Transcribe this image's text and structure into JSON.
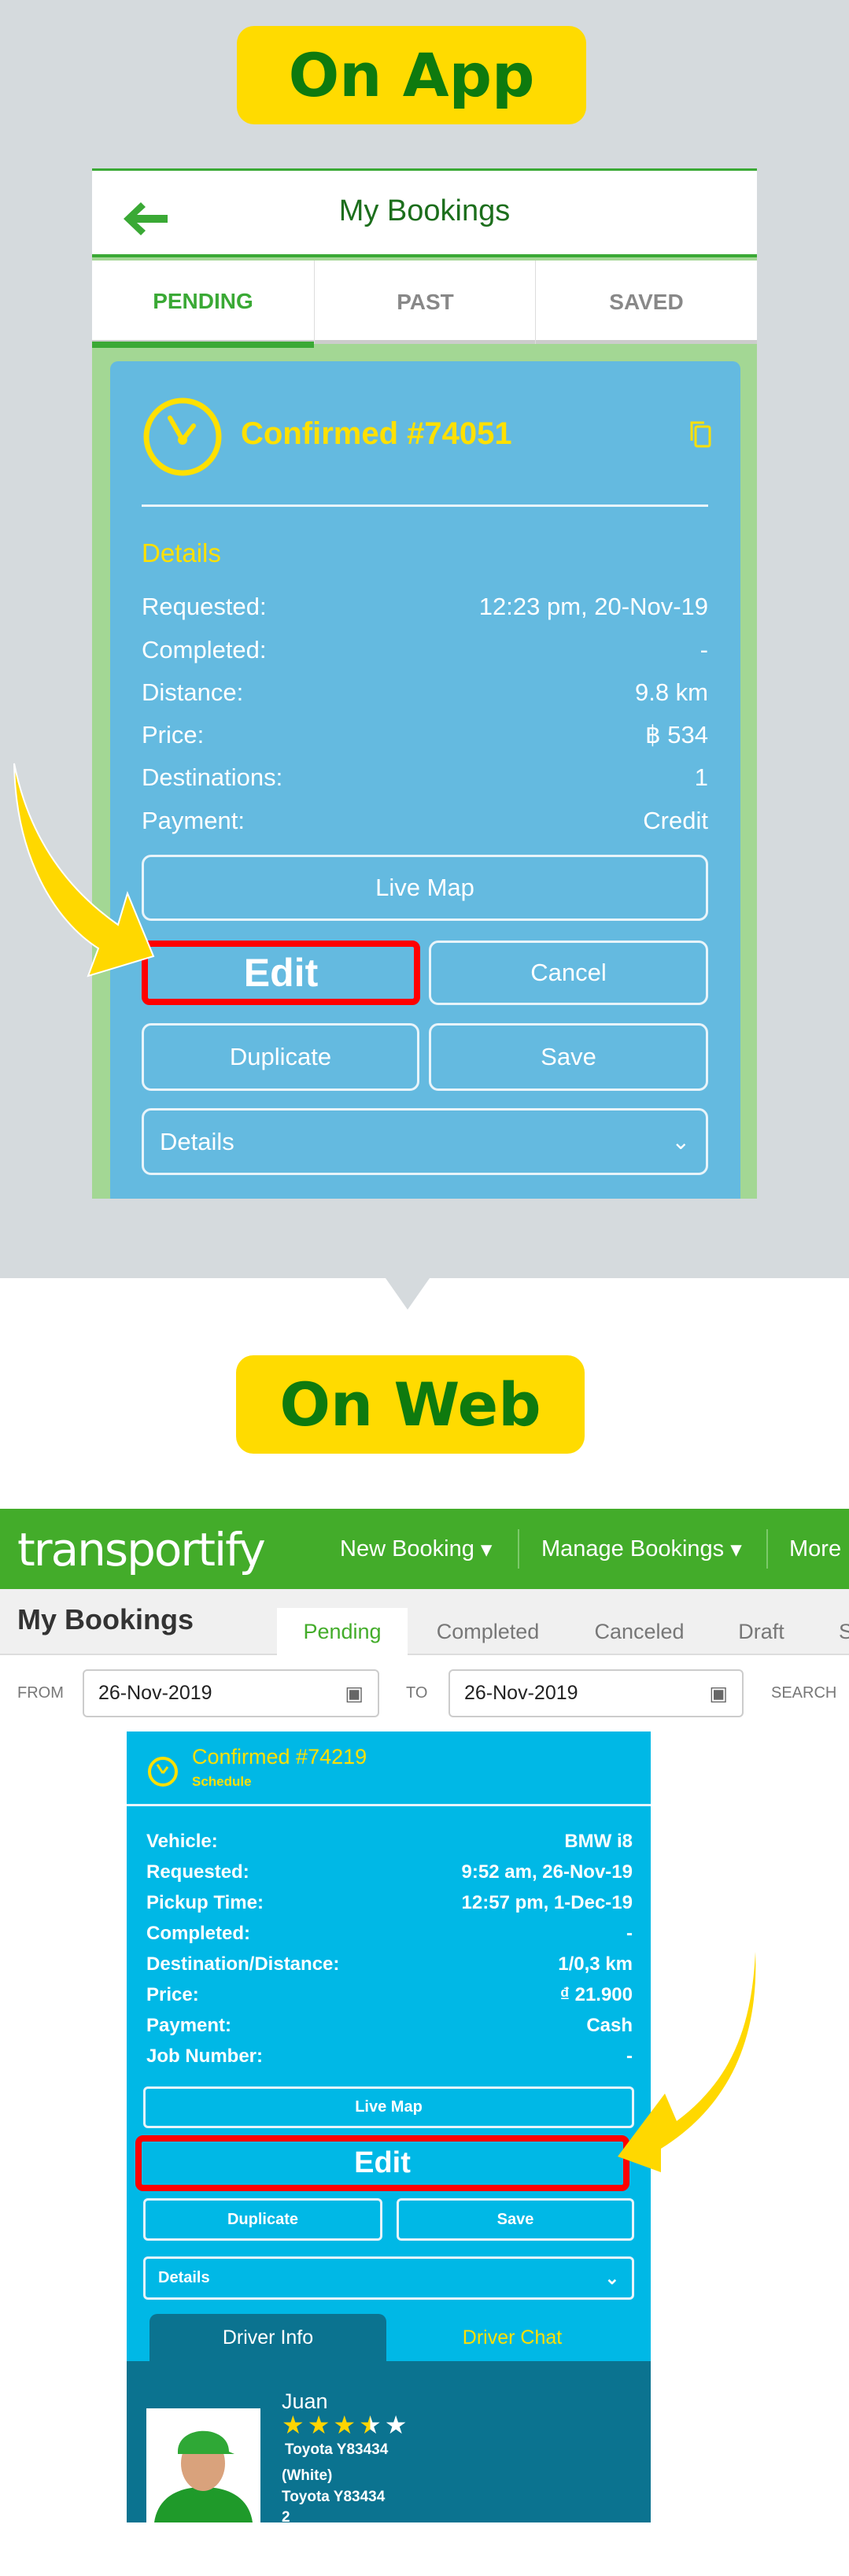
{
  "app_section": {
    "badge": "On App",
    "header": {
      "title": "My Bookings",
      "back_icon": "arrow-left-icon"
    },
    "tabs": [
      {
        "label": "PENDING",
        "active": true
      },
      {
        "label": "PAST"
      },
      {
        "label": "SAVED"
      }
    ],
    "card": {
      "status": "Confirmed #74051",
      "section": "Details",
      "rows": [
        {
          "label": "Requested:",
          "value": "12:23 pm, 20-Nov-19"
        },
        {
          "label": "Completed:",
          "value": "-"
        },
        {
          "label": "Distance:",
          "value": "9.8 km"
        },
        {
          "label": "Price:",
          "value": "฿ 534"
        },
        {
          "label": "Destinations:",
          "value": "1"
        },
        {
          "label": "Payment:",
          "value": "Credit"
        }
      ],
      "buttons": {
        "live_map": "Live Map",
        "edit": "Edit",
        "cancel": "Cancel",
        "duplicate": "Duplicate",
        "save": "Save"
      },
      "details_dropdown": "Details"
    }
  },
  "web_section": {
    "badge": "On Web",
    "logo": "transportify",
    "nav": {
      "new_booking": "New Booking",
      "manage_bookings": "Manage Bookings",
      "more": "More"
    },
    "page_title": "My Bookings",
    "tabs": [
      {
        "label": "Pending",
        "active": true
      },
      {
        "label": "Completed"
      },
      {
        "label": "Canceled"
      },
      {
        "label": "Draft"
      },
      {
        "label": "S"
      }
    ],
    "filters": {
      "from_label": "FROM",
      "from_value": "26-Nov-2019",
      "to_label": "TO",
      "to_value": "26-Nov-2019",
      "search_label": "SEARCH"
    },
    "card": {
      "status": "Confirmed #74219",
      "subtitle": "Schedule",
      "rows": [
        {
          "label": "Vehicle:",
          "value": "BMW i8"
        },
        {
          "label": "Requested:",
          "value": "9:52 am, 26-Nov-19"
        },
        {
          "label": "Pickup Time:",
          "value": "12:57 pm, 1-Dec-19"
        },
        {
          "label": "Completed:",
          "value": "-"
        },
        {
          "label": "Destination/Distance:",
          "value": "1/0,3 km"
        },
        {
          "label": "Price:",
          "value": "₫ 21.900"
        },
        {
          "label": "Payment:",
          "value": "Cash"
        },
        {
          "label": "Job Number:",
          "value": "-"
        }
      ],
      "buttons": {
        "live_map": "Live Map",
        "edit": "Edit",
        "duplicate": "Duplicate",
        "save": "Save"
      },
      "details_dropdown": "Details",
      "driver_tabs": [
        {
          "label": "Driver Info",
          "active": true
        },
        {
          "label": "Driver Chat"
        }
      ],
      "driver": {
        "name": "Juan",
        "rating": 3.5,
        "rating_max": 5,
        "vehicle_line1": "Toyota Y83434",
        "color": "(White)",
        "vehicle_line2": "Toyota Y83434",
        "extra": "2"
      }
    }
  },
  "colors": {
    "highlight": "#ff0000",
    "arrow": "#ffd800",
    "brand_green": "#43ac2a",
    "badge_yellow": "#ffdb00"
  }
}
